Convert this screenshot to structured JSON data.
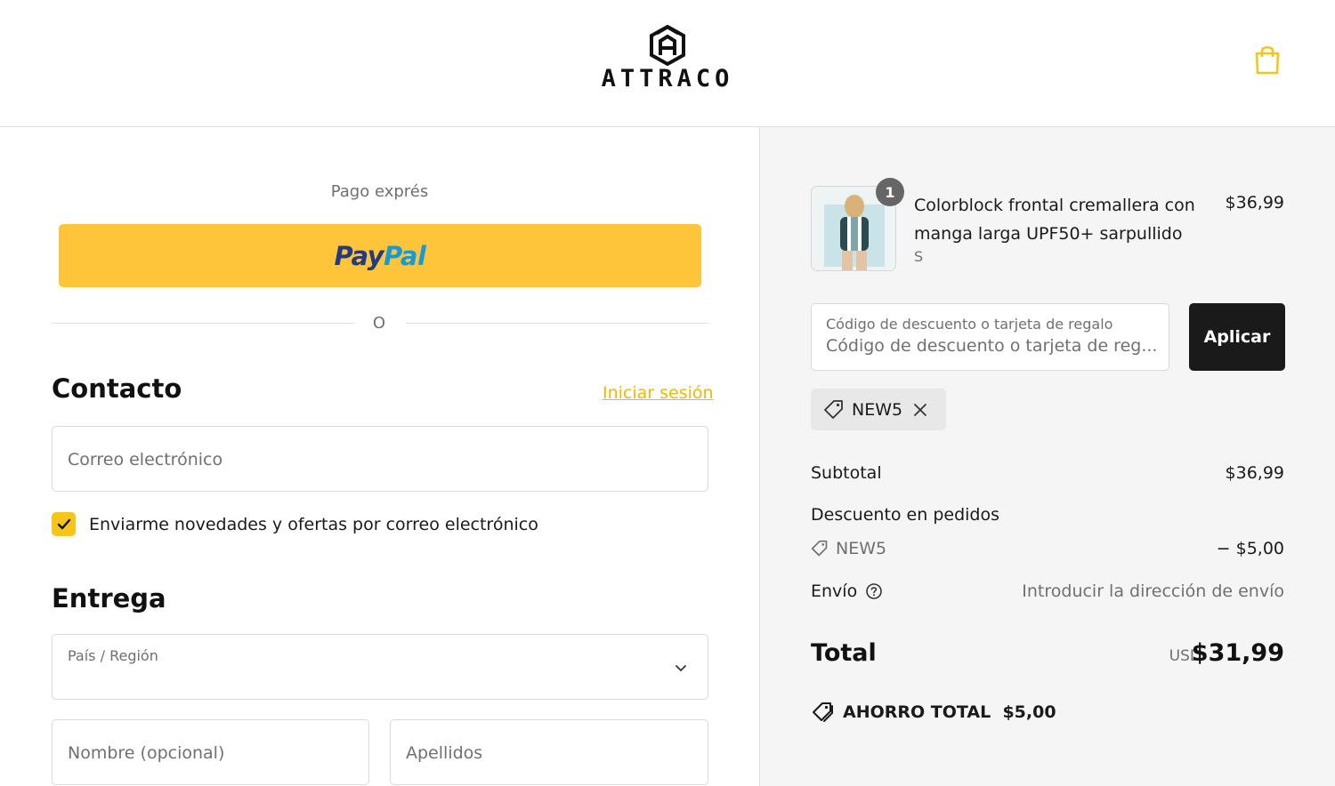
{
  "header": {
    "brand": "ATTRACO"
  },
  "express": {
    "label": "Pago exprés",
    "paypal_part1": "Pay",
    "paypal_part2": "Pal",
    "divider": "O"
  },
  "contact": {
    "title": "Contacto",
    "login_link": "Iniciar sesión",
    "email_placeholder": "Correo electrónico",
    "newsletter_label": "Enviarme novedades y ofertas por correo electrónico",
    "newsletter_checked": true
  },
  "delivery": {
    "title": "Entrega",
    "country_label": "País / Región",
    "first_name_placeholder": "Nombre (opcional)",
    "last_name_placeholder": "Apellidos"
  },
  "summary": {
    "product": {
      "quantity": "1",
      "title": "Colorblock frontal cremallera con manga larga UPF50+ sarpullido",
      "variant": "S",
      "price": "$36,99"
    },
    "discount": {
      "label": "Código de descuento o tarjeta de regalo",
      "value": "Código de descuento o tarjeta de reg...",
      "apply_label": "Aplicar",
      "applied_code": "NEW5"
    },
    "subtotal_label": "Subtotal",
    "subtotal_value": "$36,99",
    "order_discount_label": "Descuento en pedidos",
    "order_discount_code": "NEW5",
    "order_discount_value": "− $5,00",
    "shipping_label": "Envío",
    "shipping_value": "Introducir la dirección de envío",
    "total_label": "Total",
    "total_currency": "USD",
    "total_value": "$31,99",
    "savings_label": "AHORRO TOTAL",
    "savings_value": "$5,00"
  },
  "colors": {
    "accent": "#f5c518",
    "paypal_button": "#fec43a",
    "apply_button": "#1a1a1a",
    "summary_background": "#f5f5f5"
  }
}
